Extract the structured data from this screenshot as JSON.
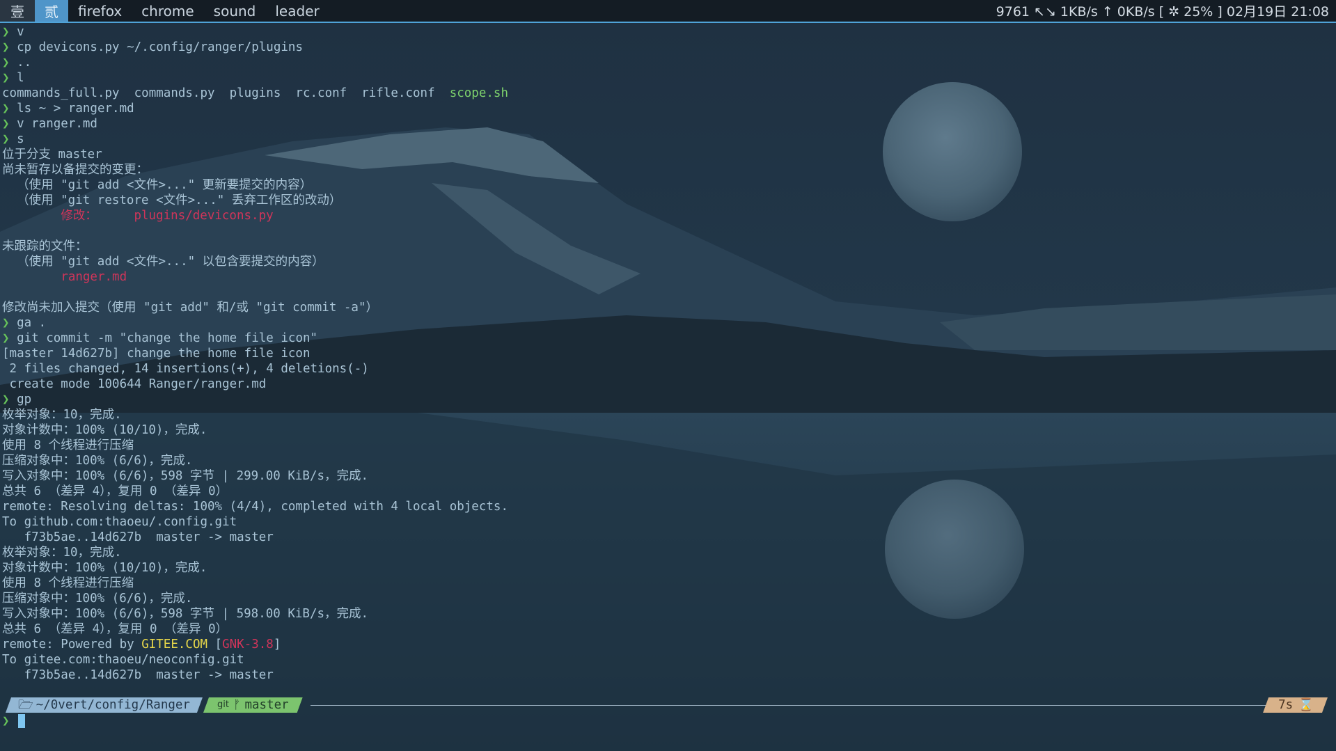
{
  "topbar": {
    "workspaces": [
      {
        "label": "壹",
        "active": false
      },
      {
        "label": "贰",
        "active": true
      },
      {
        "label": "firefox",
        "active": false
      },
      {
        "label": "chrome",
        "active": false
      },
      {
        "label": "sound",
        "active": false
      },
      {
        "label": "leader",
        "active": false
      }
    ],
    "status": "9761 ↖↘ 1KB/s ↑ 0KB/s [ ✲ 25% ] 02月19日 21:08"
  },
  "terminal": {
    "lines": [
      [
        {
          "t": "❯ ",
          "c": "pr"
        },
        {
          "t": "v",
          "c": "cmd"
        }
      ],
      [
        {
          "t": "❯ ",
          "c": "pr"
        },
        {
          "t": "cp devicons.py ~/.config/ranger/plugins",
          "c": "cmd"
        }
      ],
      [
        {
          "t": "❯ ",
          "c": "pr"
        },
        {
          "t": "..",
          "c": "cmd"
        }
      ],
      [
        {
          "t": "❯ ",
          "c": "pr"
        },
        {
          "t": "l",
          "c": "cmd"
        }
      ],
      [
        {
          "t": "commands_full.py  commands.py  plugins  rc.conf  rifle.conf  ",
          "c": "cmd"
        },
        {
          "t": "scope.sh",
          "c": "exe"
        }
      ],
      [
        {
          "t": "❯ ",
          "c": "pr"
        },
        {
          "t": "ls ~ > ranger.md",
          "c": "cmd"
        }
      ],
      [
        {
          "t": "❯ ",
          "c": "pr"
        },
        {
          "t": "v ranger.md",
          "c": "cmd"
        }
      ],
      [
        {
          "t": "❯ ",
          "c": "pr"
        },
        {
          "t": "s",
          "c": "cmd"
        }
      ],
      [
        {
          "t": "位于分支 master",
          "c": "cmd"
        }
      ],
      [
        {
          "t": "尚未暂存以备提交的变更：",
          "c": "cmd"
        }
      ],
      [
        {
          "t": "  （使用 \"git add <文件>...\" 更新要提交的内容）",
          "c": "cmd"
        }
      ],
      [
        {
          "t": "  （使用 \"git restore <文件>...\" 丢弃工作区的改动）",
          "c": "cmd"
        }
      ],
      [
        {
          "t": "        修改：     plugins/devicons.py",
          "c": "red"
        }
      ],
      [
        {
          "t": "",
          "c": "cmd"
        }
      ],
      [
        {
          "t": "未跟踪的文件：",
          "c": "cmd"
        }
      ],
      [
        {
          "t": "  （使用 \"git add <文件>...\" 以包含要提交的内容）",
          "c": "cmd"
        }
      ],
      [
        {
          "t": "        ranger.md",
          "c": "red"
        }
      ],
      [
        {
          "t": "",
          "c": "cmd"
        }
      ],
      [
        {
          "t": "修改尚未加入提交（使用 \"git add\" 和/或 \"git commit -a\"）",
          "c": "cmd"
        }
      ],
      [
        {
          "t": "❯ ",
          "c": "pr"
        },
        {
          "t": "ga .",
          "c": "cmd"
        }
      ],
      [
        {
          "t": "❯ ",
          "c": "pr"
        },
        {
          "t": "git commit -m \"change the home file icon\"",
          "c": "cmd"
        }
      ],
      [
        {
          "t": "[master 14d627b] change the home file icon",
          "c": "cmd"
        }
      ],
      [
        {
          "t": " 2 files changed, 14 insertions(+), 4 deletions(-)",
          "c": "cmd"
        }
      ],
      [
        {
          "t": " create mode 100644 Ranger/ranger.md",
          "c": "cmd"
        }
      ],
      [
        {
          "t": "❯ ",
          "c": "pr"
        },
        {
          "t": "gp",
          "c": "cmd"
        }
      ],
      [
        {
          "t": "枚举对象：10，完成.",
          "c": "cmd"
        }
      ],
      [
        {
          "t": "对象计数中：100% (10/10)，完成.",
          "c": "cmd"
        }
      ],
      [
        {
          "t": "使用 8 个线程进行压缩",
          "c": "cmd"
        }
      ],
      [
        {
          "t": "压缩对象中：100% (6/6)，完成.",
          "c": "cmd"
        }
      ],
      [
        {
          "t": "写入对象中：100% (6/6)，598 字节 | 299.00 KiB/s，完成.",
          "c": "cmd"
        }
      ],
      [
        {
          "t": "总共 6 （差异 4），复用 0 （差异 0）",
          "c": "cmd"
        }
      ],
      [
        {
          "t": "remote: Resolving deltas: 100% (4/4), completed with 4 local objects.",
          "c": "cmd"
        }
      ],
      [
        {
          "t": "To github.com:thaoeu/.config.git",
          "c": "cmd"
        }
      ],
      [
        {
          "t": "   f73b5ae..14d627b  master -> master",
          "c": "cmd"
        }
      ],
      [
        {
          "t": "枚举对象：10，完成.",
          "c": "cmd"
        }
      ],
      [
        {
          "t": "对象计数中：100% (10/10)，完成.",
          "c": "cmd"
        }
      ],
      [
        {
          "t": "使用 8 个线程进行压缩",
          "c": "cmd"
        }
      ],
      [
        {
          "t": "压缩对象中：100% (6/6)，完成.",
          "c": "cmd"
        }
      ],
      [
        {
          "t": "写入对象中：100% (6/6)，598 字节 | 598.00 KiB/s，完成.",
          "c": "cmd"
        }
      ],
      [
        {
          "t": "总共 6 （差异 4），复用 0 （差异 0）",
          "c": "cmd"
        }
      ],
      [
        {
          "t": "remote: Powered by ",
          "c": "cmd"
        },
        {
          "t": "GITEE.COM",
          "c": "yel"
        },
        {
          "t": " [",
          "c": "cmd"
        },
        {
          "t": "GNK-3.8",
          "c": "red"
        },
        {
          "t": "]",
          "c": "cmd"
        }
      ],
      [
        {
          "t": "To gitee.com:thaoeu/neoconfig.git",
          "c": "cmd"
        }
      ],
      [
        {
          "t": "   f73b5ae..14d627b  master -> master",
          "c": "cmd"
        }
      ]
    ]
  },
  "prompt": {
    "folder_icon": "folder-icon",
    "path": "~/0vert/config/Ranger",
    "git_label": "git",
    "branch_icon": "branch-icon",
    "branch": "master",
    "duration": "7s",
    "hourglass_icon": "hourglass-icon",
    "input_prompt": "❯"
  }
}
